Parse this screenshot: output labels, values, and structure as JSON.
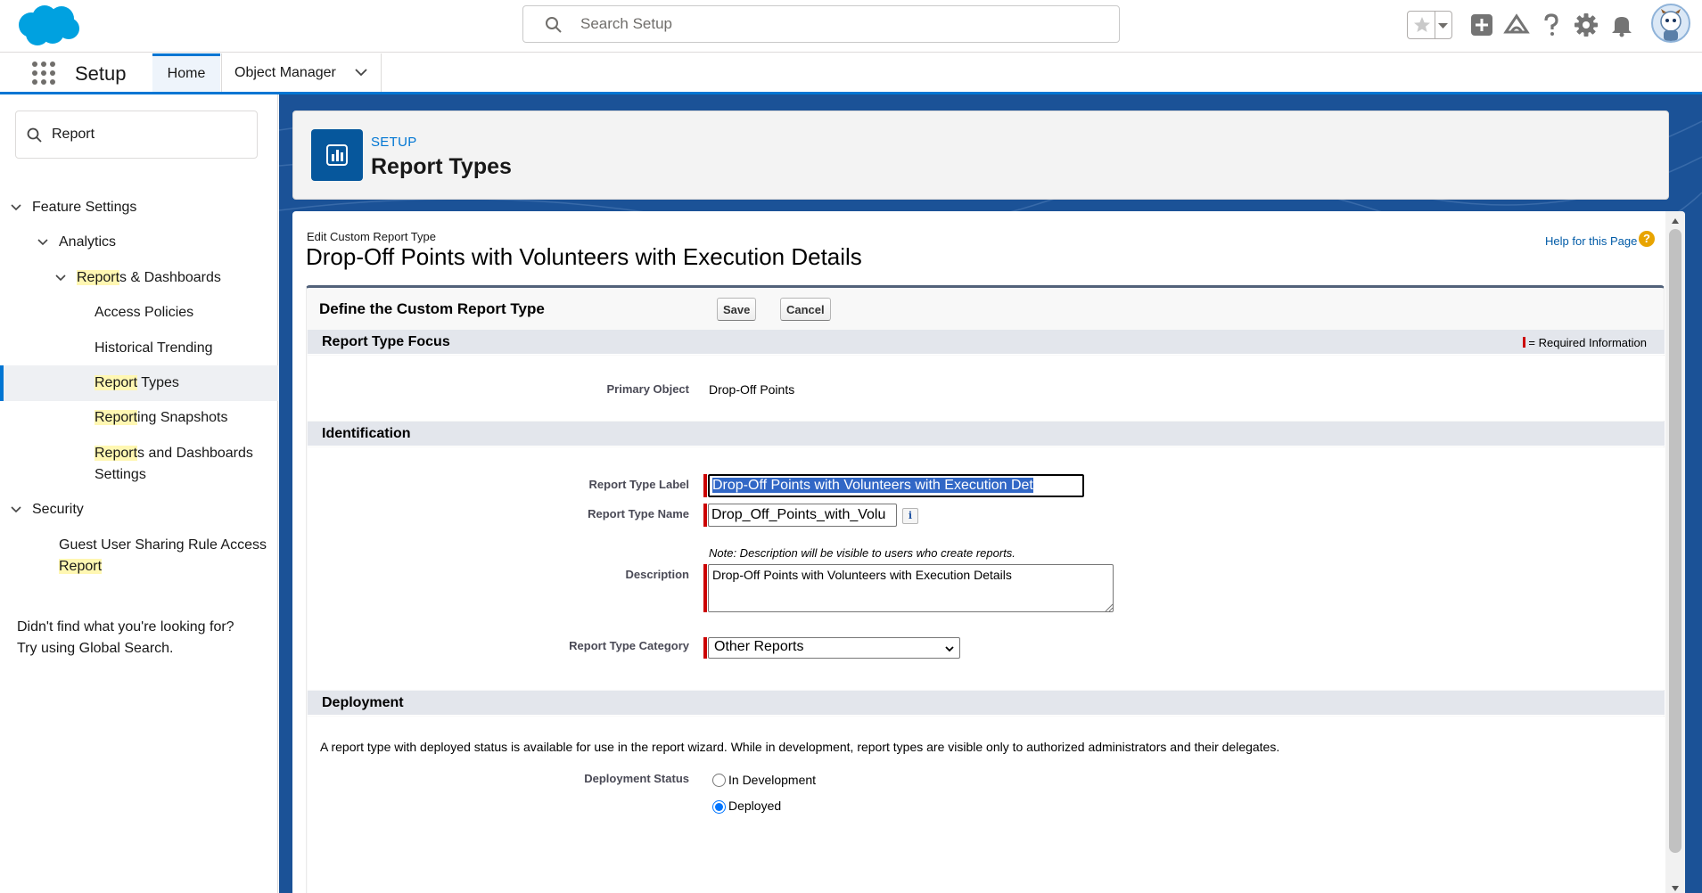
{
  "header": {
    "search_placeholder": "Search Setup"
  },
  "nav": {
    "app_name": "Setup",
    "tabs": [
      {
        "label": "Home",
        "active": true
      },
      {
        "label": "Object Manager",
        "active": false
      }
    ]
  },
  "sidebar": {
    "quick_find_value": "Report",
    "tree": {
      "feature_settings": "Feature Settings",
      "analytics": "Analytics",
      "reports_dashboards_hl": "Report",
      "reports_dashboards_rest": "s & Dashboards",
      "access_policies": "Access Policies",
      "historical_trending": "Historical Trending",
      "report_types_hl": "Report",
      "report_types_rest": " Types",
      "reporting_snapshots_hl": "Report",
      "reporting_snapshots_rest": "ing Snapshots",
      "reports_settings_hl": "Report",
      "reports_settings_rest": "s and Dashboards",
      "reports_settings_line2": "Settings",
      "security": "Security",
      "guest_user_line1": "Guest User Sharing Rule Access",
      "guest_user_line2_hl": "Report"
    },
    "not_found_line1": "Didn't find what you're looking for?",
    "not_found_line2": "Try using Global Search."
  },
  "page_header": {
    "eyebrow": "SETUP",
    "title": "Report Types"
  },
  "edit": {
    "eyebrow": "Edit Custom Report Type",
    "title": "Drop-Off Points with Volunteers with Execution Details",
    "help_link": "Help for this Page",
    "help_icon": "?",
    "panel_title": "Define the Custom Report Type",
    "save_label": "Save",
    "cancel_label": "Cancel",
    "required_legend": "= Required Information",
    "sections": {
      "focus": "Report Type Focus",
      "identification": "Identification",
      "deployment": "Deployment"
    },
    "primary_object_label": "Primary Object",
    "primary_object_value": "Drop-Off Points",
    "report_type_label_label": "Report Type Label",
    "report_type_label_value": "Drop-Off Points with Volunteers with Execution Det",
    "report_type_name_label": "Report Type Name",
    "report_type_name_value": "Drop_Off_Points_with_Volu",
    "info_icon": "i",
    "description_note": "Note: Description will be visible to users who create reports.",
    "description_label": "Description",
    "description_value": "Drop-Off Points with Volunteers with Execution Details",
    "category_label": "Report Type Category",
    "category_value": "Other Reports",
    "deployment_text": "A report type with deployed status is available for use in the report wizard. While in development, report types are visible only to authorized administrators and their delegates.",
    "deployment_status_label": "Deployment Status",
    "deployment_options": [
      {
        "label": "In Development",
        "checked": false
      },
      {
        "label": "Deployed",
        "checked": true
      }
    ]
  },
  "colors": {
    "brand_blue": "#0176d3",
    "header_icon_bg": "#06579c",
    "required": "#cc0000",
    "selection": "#3167c6"
  }
}
